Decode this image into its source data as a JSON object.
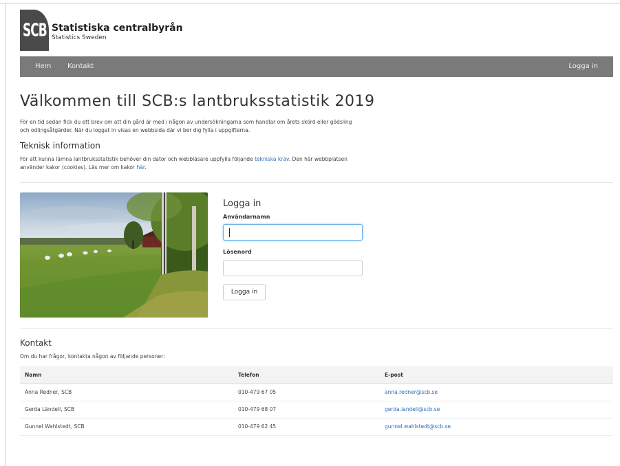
{
  "header": {
    "logo_text": "SCB",
    "org_name": "Statistiska centralbyrån",
    "org_sub": "Statistics Sweden"
  },
  "nav": {
    "home": "Hem",
    "contact": "Kontakt",
    "login": "Logga in"
  },
  "main": {
    "title": "Välkommen till SCB:s lantbruksstatistik 2019",
    "intro_line1": "För en tid sedan fick du ett brev om att din gård är med i någon av undersökningarna som handlar om årets skörd eller gödsling",
    "intro_line2": "och odlingsåtgärder. När du loggat in visas en webbsida där vi ber dig fylla i uppgifterna.",
    "tech_heading": "Teknisk information",
    "tech_text_a": "För att kunna lämna lantbruksstatistik behöver din dator och webbläsare uppfylla följande ",
    "tech_link": "tekniska krav",
    "tech_text_b": ". Den här webbplatsen",
    "tech_text_c": "använder kakor (cookies). Läs mer om kakor ",
    "cookie_link": "här",
    "tech_text_d": "."
  },
  "login": {
    "title": "Logga in",
    "username_label": "Användarnamn",
    "username_value": "",
    "password_label": "Lösenord",
    "password_value": "",
    "button": "Logga in"
  },
  "contact": {
    "heading": "Kontakt",
    "text": "Om du har frågor, kontakta någon av följande personer:",
    "columns": [
      "Namn",
      "Telefon",
      "E-post"
    ],
    "rows": [
      {
        "name": "Anna Redner, SCB",
        "phone": "010-479 67 05",
        "email": "anna.redner@scb.se"
      },
      {
        "name": "Gerda Ländell, SCB",
        "phone": "010-479 68 07",
        "email": "gerda.landell@scb.se"
      },
      {
        "name": "Gunnel Wahlstedt, SCB",
        "phone": "010-479 62 45",
        "email": "gunnel.wahlstedt@scb.se"
      }
    ]
  },
  "colors": {
    "navbar": "#7a7a7a",
    "link": "#2a6ebb",
    "logo": "#4a4a4a"
  }
}
